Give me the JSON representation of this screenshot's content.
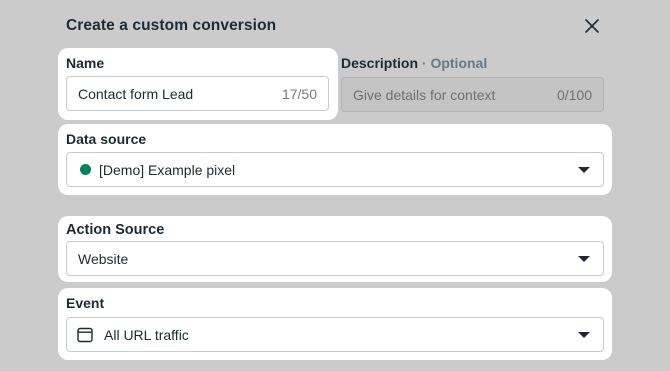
{
  "dialog": {
    "title": "Create a custom conversion"
  },
  "name": {
    "label": "Name",
    "value": "Contact form Lead",
    "counter": "17/50"
  },
  "description": {
    "label": "Description",
    "optional": "· Optional",
    "placeholder": "Give details for context",
    "counter": "0/100"
  },
  "data_source": {
    "label": "Data source",
    "value": "[Demo] Example pixel",
    "status_color": "#00835f"
  },
  "action_source": {
    "label": "Action Source",
    "value": "Website"
  },
  "event": {
    "label": "Event",
    "value": "All URL traffic"
  },
  "icons": {
    "close": "close-icon",
    "dropdown": "chevron-down-icon",
    "event": "browser-window-icon",
    "status": "status-dot-icon"
  }
}
